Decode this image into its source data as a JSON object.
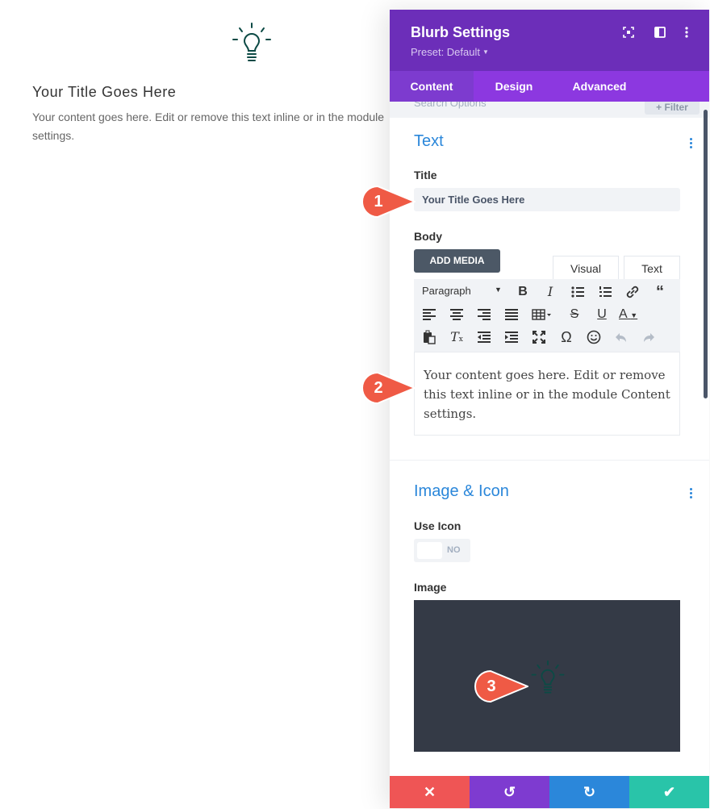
{
  "preview": {
    "icon": "lightbulb-icon",
    "title": "Your Title Goes Here",
    "body": "Your content goes here. Edit or remove this text inline or in the module\nsettings."
  },
  "panel": {
    "title": "Blurb Settings",
    "preset": "Preset: Default",
    "header_icons": [
      "expand-icon",
      "sidebar-toggle-icon",
      "more-options-icon"
    ],
    "tabs": [
      {
        "label": "Content",
        "active": true
      },
      {
        "label": "Design",
        "active": false
      },
      {
        "label": "Advanced",
        "active": false
      }
    ],
    "search_placeholder": "Search Options",
    "filter_label": "+ Filter"
  },
  "text_section": {
    "title": "Text",
    "title_label": "Title",
    "title_value": "Your Title Goes Here",
    "body_label": "Body",
    "add_media": "ADD MEDIA",
    "mode_tabs": [
      "Visual",
      "Text"
    ],
    "active_mode": "Visual",
    "format_select": "Paragraph",
    "toolbar_icons": [
      "bold-icon",
      "italic-icon",
      "bullet-list-icon",
      "numbered-list-icon",
      "link-icon",
      "blockquote-icon",
      "align-left-icon",
      "align-center-icon",
      "align-right-icon",
      "justify-icon",
      "table-icon",
      "strikethrough-icon",
      "underline-icon",
      "text-color-icon",
      "paste-icon",
      "clear-format-icon",
      "outdent-icon",
      "indent-icon",
      "fullscreen-icon",
      "special-char-icon",
      "emoji-icon",
      "undo-icon",
      "redo-icon"
    ],
    "editor_content": "Your content goes here. Edit or remove this text inline or in the module Content settings."
  },
  "image_section": {
    "title": "Image & Icon",
    "use_icon_label": "Use Icon",
    "use_icon_value": "NO",
    "image_label": "Image",
    "image_icon": "lightbulb-icon"
  },
  "footer": {
    "buttons": [
      {
        "name": "discard-button",
        "icon": "close-icon",
        "color": "#ef5555"
      },
      {
        "name": "undo-button",
        "icon": "undo-icon",
        "color": "#7e3bd0"
      },
      {
        "name": "redo-button",
        "icon": "redo-icon",
        "color": "#2b87da"
      },
      {
        "name": "save-button",
        "icon": "check-icon",
        "color": "#29c4a9"
      }
    ]
  },
  "callouts": [
    "1",
    "2",
    "3"
  ],
  "colors": {
    "header": "#6c2eb9",
    "tabs": "#8c38e0",
    "accent_blue": "#2b87da",
    "callout": "#ef5a45",
    "icon_teal": "#0c4a45"
  }
}
